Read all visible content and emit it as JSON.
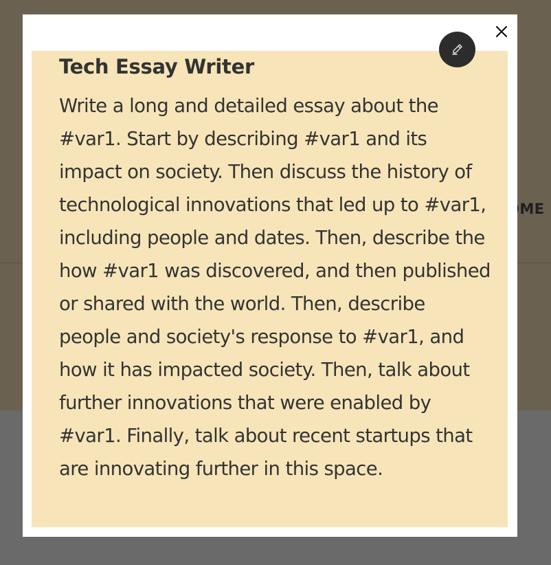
{
  "background": {
    "nav_partial_label": "OME"
  },
  "modal": {
    "close_symbol": "✕",
    "card": {
      "title": "Tech Essay Writer",
      "body": "Write a long and detailed essay about the #var1. Start by describing #var1 and its impact on society. Then discuss the history of technological innovations that led up to #var1, including people and dates. Then, describe the how #var1 was discovered, and then published or shared with the world. Then, describe people and society's response to #var1, and how it has impacted society. Then, talk about further innovations that were enabled by #var1. Finally, talk about recent startups that are innovating further in this space.",
      "edit_icon": "pencil-icon"
    }
  },
  "colors": {
    "backdrop": "#6b6150",
    "backdrop_lower": "#6a6a6a",
    "card_background": "#f7e5b9",
    "edit_button": "#2c2c2c",
    "text": "#333333"
  }
}
